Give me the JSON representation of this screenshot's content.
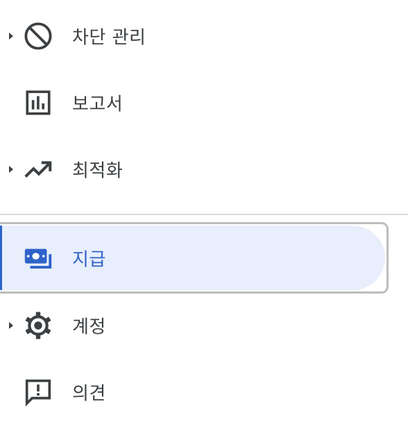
{
  "nav": {
    "items": [
      {
        "label": "차단 관리",
        "icon": "block-icon",
        "expandable": true
      },
      {
        "label": "보고서",
        "icon": "bar-chart-icon",
        "expandable": false
      },
      {
        "label": "최적화",
        "icon": "trending-up-icon",
        "expandable": true
      },
      {
        "label": "지급",
        "icon": "payments-icon",
        "expandable": false,
        "selected": true
      },
      {
        "label": "계정",
        "icon": "settings-icon",
        "expandable": true
      },
      {
        "label": "의견",
        "icon": "feedback-icon",
        "expandable": false
      }
    ]
  },
  "colors": {
    "text": "#3c4043",
    "accent": "#2f63c9",
    "selected_background": "#e8eefb",
    "divider": "#dadce0"
  }
}
